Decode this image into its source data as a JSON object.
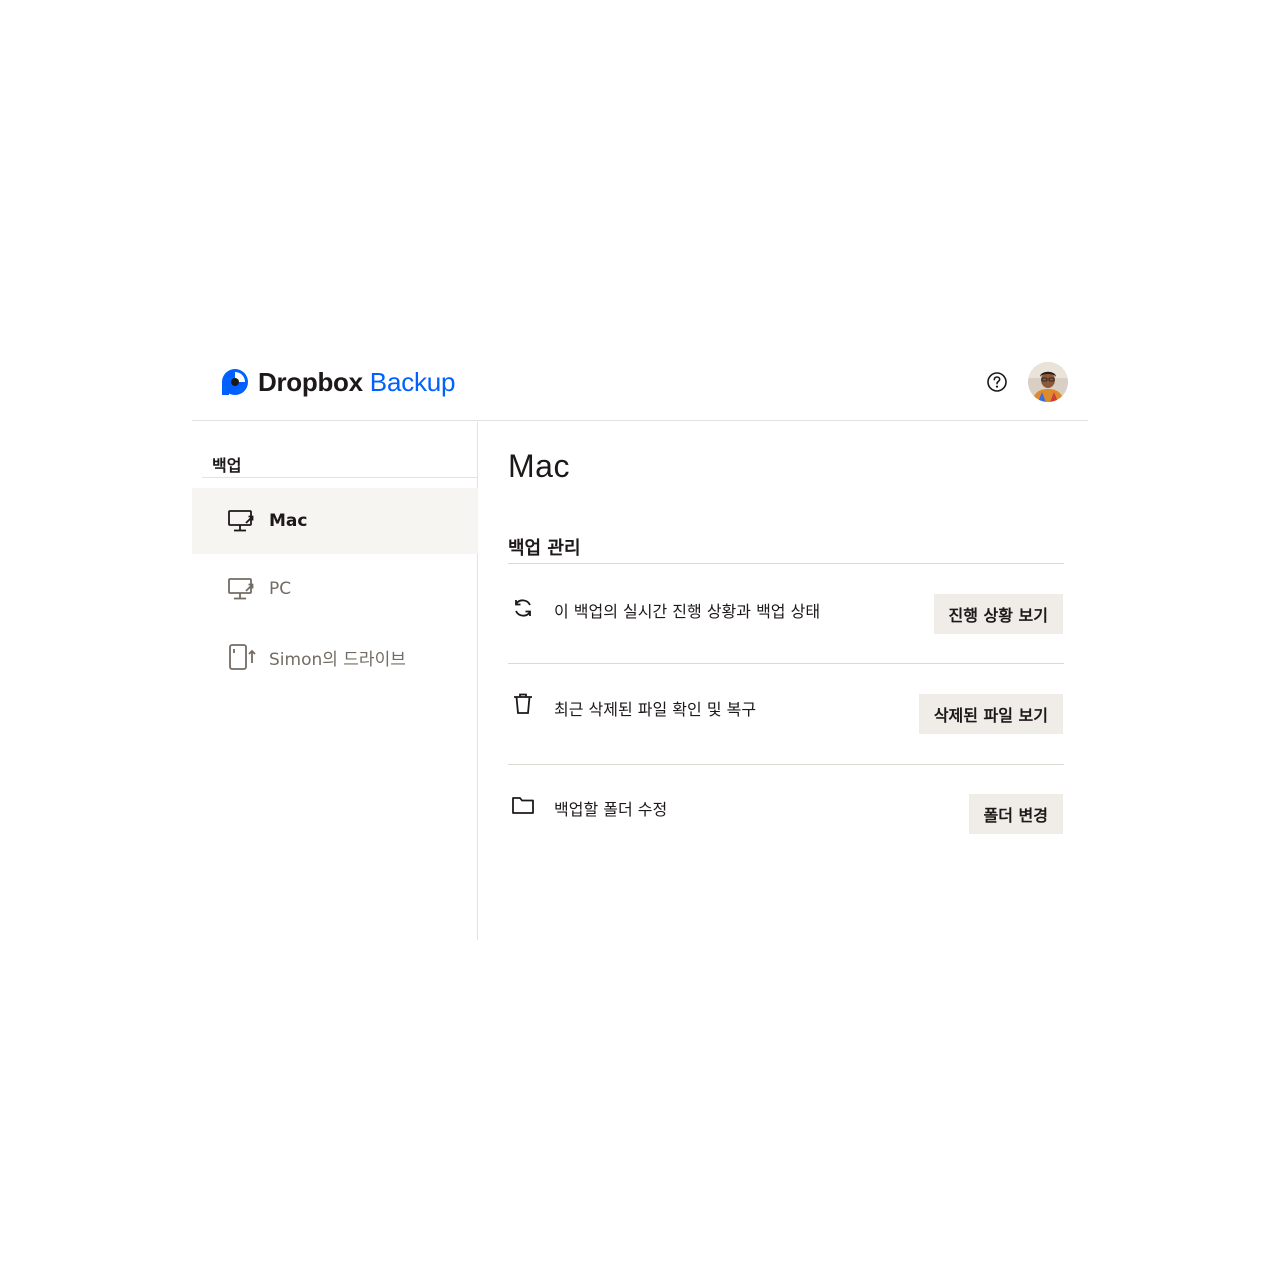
{
  "header": {
    "brand_name": "Dropbox",
    "brand_product": "Backup",
    "brand_color": "#0061fe",
    "help_icon": "help-circle-icon",
    "avatar_alt": "user-avatar"
  },
  "sidebar": {
    "heading": "백업",
    "items": [
      {
        "label": "Mac",
        "icon": "desktop-backup-icon",
        "active": true
      },
      {
        "label": "PC",
        "icon": "desktop-backup-icon",
        "active": false
      },
      {
        "label": "Simon의 드라이브",
        "icon": "external-drive-icon",
        "active": false
      }
    ]
  },
  "main": {
    "title": "Mac",
    "section_heading": "백업 관리",
    "rows": [
      {
        "icon": "sync-icon",
        "text": "이 백업의 실시간 진행 상황과 백업 상태",
        "button": "진행 상황 보기"
      },
      {
        "icon": "trash-icon",
        "text": "최근 삭제된 파일 확인 및 복구",
        "button": "삭제된 파일 보기"
      },
      {
        "icon": "folder-icon",
        "text": "백업할 폴더 수정",
        "button": "폴더 변경"
      }
    ]
  },
  "colors": {
    "active_background": "#f7f5f2",
    "button_background": "#f0ede9",
    "text_primary": "#1e1919",
    "text_muted": "#736c64"
  }
}
